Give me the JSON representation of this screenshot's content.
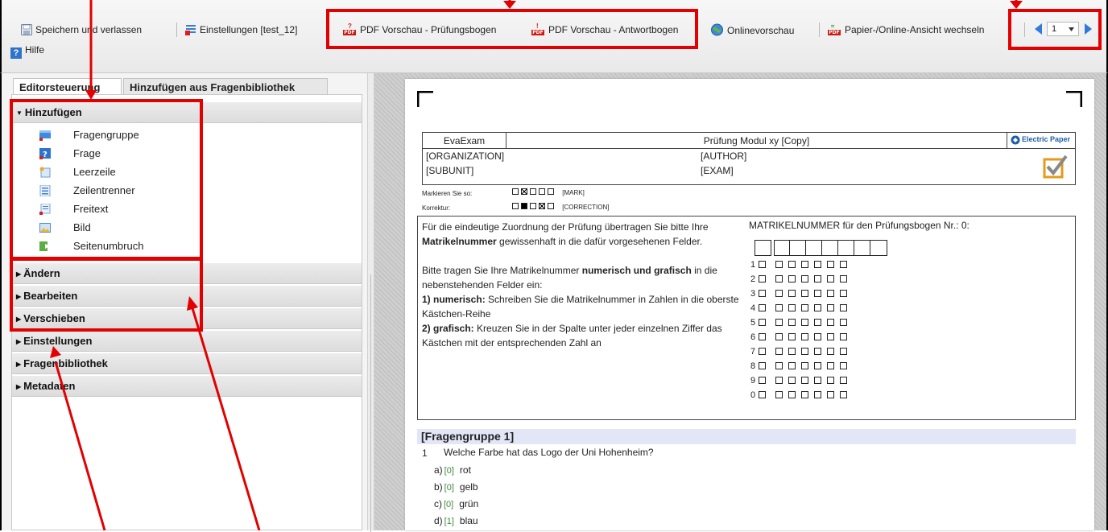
{
  "toolbar": {
    "save_exit": "Speichern und verlassen",
    "settings": "Einstellungen [test_12]",
    "pdf_exam": "PDF Vorschau - Prüfungsbogen",
    "pdf_answer": "PDF Vorschau - Antwortbogen",
    "online_preview": "Onlinevorschau",
    "toggle_view": "Papier-/Online-Ansicht wechseln",
    "page_select": "1",
    "help": "Hilfe"
  },
  "left": {
    "tabs": [
      "Editorsteuerung",
      "Hinzufügen aus Fragenbibliothek"
    ],
    "sections": [
      "Hinzufügen",
      "Ändern",
      "Bearbeiten",
      "Verschieben",
      "Einstellungen",
      "Fragenbibliothek",
      "Metadaten"
    ],
    "add_items": [
      "Fragengruppe",
      "Frage",
      "Leerzeile",
      "Zeilentrenner",
      "Freitext",
      "Bild",
      "Seitenumbruch"
    ]
  },
  "doc": {
    "header": {
      "evaexam": "EvaExam",
      "title": "Prüfung Modul xy [Copy]",
      "logo_text": "Electric Paper",
      "organization": "[ORGANIZATION]",
      "author": "[AUTHOR]",
      "subunit": "[SUBUNIT]",
      "exam": "[EXAM]"
    },
    "mark_label": "Markieren Sie so:",
    "mark_tag": "[MARK]",
    "correct_label": "Korrektur:",
    "correct_tag": "[CORRECTION]",
    "instructions": {
      "p1a": "Für die eindeutige Zuordnung der Prüfung übertragen Sie bitte Ihre ",
      "p1b": "Matrikelnummer",
      "p1c": " gewissenhaft in die dafür vorgesehenen Felder.",
      "p2a": "Bitte tragen Sie Ihre Matrikelnummer ",
      "p2b": "numerisch und grafisch",
      "p2c": " in die nebenstehenden Felder ein:",
      "p3a": "1) numerisch:",
      "p3b": " Schreiben Sie die Matrikelnummer in Zahlen in die oberste Kästchen-Reihe",
      "p4a": "2) grafisch:",
      "p4b": " Kreuzen Sie in der Spalte unter jeder einzelnen Ziffer das Kästchen mit der entsprechenden Zahl an"
    },
    "matrikel_title": "MATRIKELNUMMER für den Prüfungsbogen Nr.: 0:",
    "digits": [
      "1",
      "2",
      "3",
      "4",
      "5",
      "6",
      "7",
      "8",
      "9",
      "0"
    ],
    "group_title": "[Fragengruppe 1]",
    "question": {
      "num": "1",
      "text": "Welche Farbe hat das Logo der Uni Hohenheim?",
      "answers": [
        {
          "letter": "a)",
          "score": "[0]",
          "text": "rot"
        },
        {
          "letter": "b)",
          "score": "[0]",
          "text": "gelb"
        },
        {
          "letter": "c)",
          "score": "[0]",
          "text": "grün"
        },
        {
          "letter": "d)",
          "score": "[1]",
          "text": "blau"
        }
      ]
    }
  },
  "colors": {
    "annotation": "#e20000",
    "group_band": "#e3e6f7",
    "score": "#3a8a3a",
    "pdf_red": "#cc1a12"
  }
}
